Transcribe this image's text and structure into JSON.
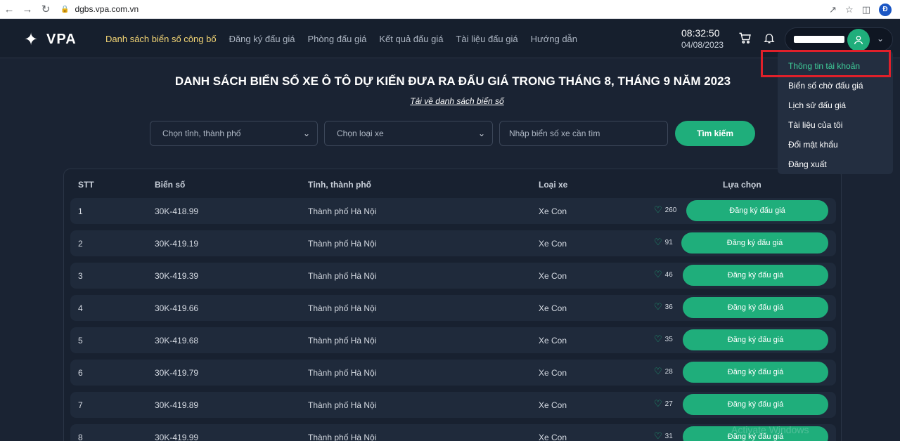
{
  "browser": {
    "url": "dgbs.vpa.com.vn",
    "profile_initial": "Đ"
  },
  "header": {
    "logo_text": "VPA",
    "nav": [
      {
        "label": "Danh sách biển số công bố"
      },
      {
        "label": "Đăng ký đấu giá"
      },
      {
        "label": "Phòng đấu giá"
      },
      {
        "label": "Kết quả đấu giá"
      },
      {
        "label": "Tài liệu đấu giá"
      },
      {
        "label": "Hướng dẫn"
      }
    ],
    "time": "08:32:50",
    "date": "04/08/2023"
  },
  "page": {
    "title": "DANH SÁCH BIỂN SỐ XE Ô TÔ DỰ KIẾN ĐƯA RA ĐẤU GIÁ TRONG THÁNG 8, THÁNG 9 NĂM 2023",
    "download_link": "Tải về danh sách biển số"
  },
  "filters": {
    "province_placeholder": "Chọn tỉnh, thành phố",
    "vehicle_placeholder": "Chọn loại xe",
    "plate_placeholder": "Nhập biển số xe cần tìm",
    "search_label": "Tìm kiếm"
  },
  "table": {
    "headers": {
      "stt": "STT",
      "plate": "Biển số",
      "province": "Tỉnh, thành phố",
      "type": "Loại xe",
      "action": "Lựa chọn"
    },
    "button_label": "Đăng ký đấu giá",
    "rows": [
      {
        "stt": "1",
        "plate": "30K-418.99",
        "province": "Thành phố Hà Nội",
        "type": "Xe Con",
        "likes": "260"
      },
      {
        "stt": "2",
        "plate": "30K-419.19",
        "province": "Thành phố Hà Nội",
        "type": "Xe Con",
        "likes": "91"
      },
      {
        "stt": "3",
        "plate": "30K-419.39",
        "province": "Thành phố Hà Nội",
        "type": "Xe Con",
        "likes": "46"
      },
      {
        "stt": "4",
        "plate": "30K-419.66",
        "province": "Thành phố Hà Nội",
        "type": "Xe Con",
        "likes": "36"
      },
      {
        "stt": "5",
        "plate": "30K-419.68",
        "province": "Thành phố Hà Nội",
        "type": "Xe Con",
        "likes": "35"
      },
      {
        "stt": "6",
        "plate": "30K-419.79",
        "province": "Thành phố Hà Nội",
        "type": "Xe Con",
        "likes": "28"
      },
      {
        "stt": "7",
        "plate": "30K-419.89",
        "province": "Thành phố Hà Nội",
        "type": "Xe Con",
        "likes": "27"
      },
      {
        "stt": "8",
        "plate": "30K-419.99",
        "province": "Thành phố Hà Nội",
        "type": "Xe Con",
        "likes": "31"
      }
    ]
  },
  "user_menu": {
    "items": [
      {
        "label": "Thông tin tài khoản"
      },
      {
        "label": "Biển số chờ đấu giá"
      },
      {
        "label": "Lịch sử đấu giá"
      },
      {
        "label": "Tài liệu của tôi"
      },
      {
        "label": "Đổi mật khẩu"
      },
      {
        "label": "Đăng xuất"
      }
    ]
  },
  "watermark": "Activate Windows",
  "colors": {
    "accent": "#1fae7b",
    "nav_active": "#f4d675",
    "highlight": "#e0202a",
    "background": "#1a2333"
  }
}
